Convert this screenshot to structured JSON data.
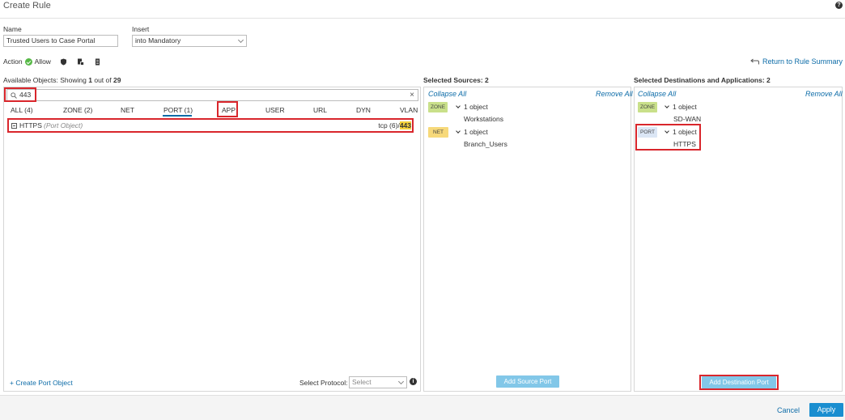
{
  "header": {
    "title": "Create Rule",
    "help_icon": "help-icon"
  },
  "form": {
    "name_label": "Name",
    "name_value": "Trusted Users to Case Portal",
    "insert_label": "Insert",
    "insert_value": "into Mandatory",
    "action_label": "Action",
    "action_value": "Allow",
    "return_link": "Return to Rule Summary"
  },
  "available": {
    "label_prefix": "Available Objects: Showing",
    "count_shown": "1",
    "label_middle": "out of",
    "count_total": "29",
    "search_value": "443",
    "tabs": [
      "ALL (4)",
      "ZONE (2)",
      "NET",
      "PORT (1)",
      "APP",
      "USER",
      "URL",
      "DYN",
      "VLAN"
    ],
    "active_tab": "PORT (1)",
    "result": {
      "name": "HTTPS",
      "type": "(Port Object)",
      "proto_prefix": "tcp (6)/",
      "proto_match": "443"
    },
    "create_link": "+ Create Port Object",
    "protocol_label": "Select Protocol:",
    "protocol_value": "Select"
  },
  "sources": {
    "title": "Selected Sources: 2",
    "collapse": "Collapse All",
    "remove": "Remove All",
    "items": [
      {
        "badge": "ZONE",
        "header": "1 object",
        "value": "Workstations"
      },
      {
        "badge": "NET",
        "header": "1 object",
        "value": "Branch_Users"
      }
    ],
    "add_button": "Add Source Port"
  },
  "destinations": {
    "title": "Selected Destinations and Applications: 2",
    "collapse": "Collapse All",
    "remove": "Remove All",
    "items": [
      {
        "badge": "ZONE",
        "header": "1 object",
        "value": "SD-WAN"
      },
      {
        "badge": "PORT",
        "header": "1 object",
        "value": "HTTPS"
      }
    ],
    "add_button": "Add Destination Port"
  },
  "footer": {
    "cancel": "Cancel",
    "apply": "Apply"
  },
  "colors": {
    "accent": "#0d6ca8",
    "highlight": "#d9262c",
    "apply_bg": "#1a8ed0"
  }
}
